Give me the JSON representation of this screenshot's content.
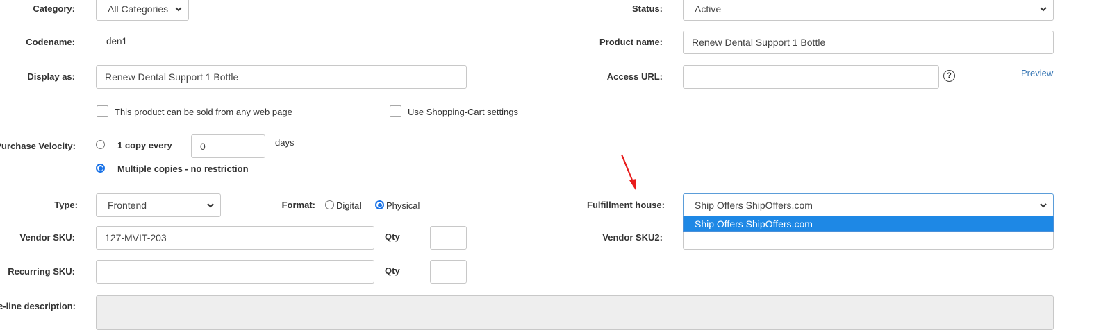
{
  "category": {
    "label": "Category:",
    "value": "All Categories"
  },
  "status": {
    "label": "Status:",
    "value": "Active"
  },
  "codename": {
    "label": "Codename:",
    "value": "den1"
  },
  "product_name": {
    "label": "Product name:",
    "value": "Renew Dental Support 1 Bottle"
  },
  "display_as": {
    "label": "Display as:",
    "value": "Renew Dental Support 1 Bottle"
  },
  "access_url": {
    "label": "Access URL:",
    "value": "",
    "help": "?",
    "preview": "Preview"
  },
  "checkboxes": {
    "any_web_page": "This product can be sold from any web page",
    "shopping_cart": "Use Shopping-Cart settings"
  },
  "purchase_velocity": {
    "label": "Purchase Velocity:",
    "option_one": "1 copy every",
    "days_value": "0",
    "days_unit": "days",
    "option_multiple": "Multiple copies - no restriction"
  },
  "type": {
    "label": "Type:",
    "value": "Frontend"
  },
  "format": {
    "label": "Format:",
    "digital": "Digital",
    "physical": "Physical"
  },
  "fulfillment": {
    "label": "Fulfillment house:",
    "value": "Ship Offers ShipOffers.com",
    "highlighted_option": "Ship Offers ShipOffers.com"
  },
  "vendor_sku": {
    "label": "Vendor SKU:",
    "value": "127-MVIT-203",
    "qty_label": "Qty",
    "qty_value": ""
  },
  "vendor_sku2": {
    "label": "Vendor SKU2:"
  },
  "recurring_sku": {
    "label": "Recurring SKU:",
    "value": "",
    "qty_label": "Qty",
    "qty_value": ""
  },
  "one_line_description": {
    "label": "e-line description:"
  },
  "colors": {
    "accent": "#1e88e5",
    "link": "#3a78b5",
    "annotation_arrow": "#e81c1c"
  }
}
